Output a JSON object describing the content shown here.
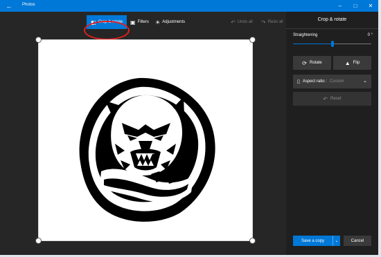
{
  "window": {
    "title": "Photos",
    "back_icon": "back-arrow-icon",
    "controls": [
      "minimize-icon",
      "maximize-icon",
      "close-icon"
    ]
  },
  "toolbar": {
    "crop_label": "Crop & rotate",
    "filters_label": "Filters",
    "adjustments_label": "Adjustments",
    "undo_label": "Undo all",
    "redo_label": "Redo all"
  },
  "panel": {
    "title": "Crop & rotate",
    "straightening_label": "Straightening",
    "straightening_value": "0 °",
    "straightening_level": 0.5,
    "rotate_label": "Rotate",
    "flip_label": "Flip",
    "aspect_label": "Aspect ratio :",
    "aspect_value": "Custom",
    "reset_label": "Reset",
    "save_label": "Save a copy",
    "cancel_label": "Cancel"
  },
  "colors": {
    "accent": "#0078d7",
    "annotation": "#e02020"
  }
}
